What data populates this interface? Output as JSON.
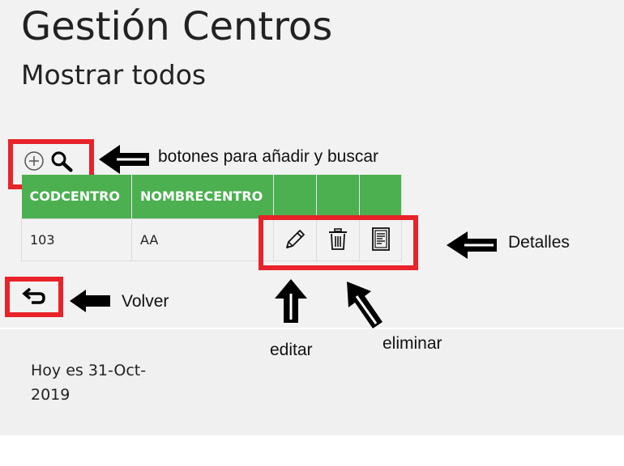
{
  "header": {
    "title": "Gestión Centros",
    "subtitle": "Mostrar todos"
  },
  "toolbar": {
    "add_icon": "plus-circle-icon",
    "search_icon": "magnifier-icon"
  },
  "table": {
    "columns": [
      "CODCENTRO",
      "NOMBRECENTRO",
      "",
      "",
      ""
    ],
    "rows": [
      {
        "codcentro": "103",
        "nombrecentro": "AA"
      }
    ],
    "row_actions": {
      "edit_icon": "pencil-icon",
      "delete_icon": "trash-icon",
      "details_icon": "document-icon"
    }
  },
  "back_icon": "return-arrow-icon",
  "annotations": {
    "buttons_note": "botones para añadir y buscar",
    "details_note": "Detalles",
    "back_note": "Volver",
    "edit_note": "editar",
    "delete_note": "eliminar"
  },
  "footer": {
    "date_text": "Hoy es 31-Oct-2019"
  },
  "colors": {
    "header_green": "#4caf50",
    "highlight_red": "#e8232a",
    "background": "#f2f2f2"
  }
}
